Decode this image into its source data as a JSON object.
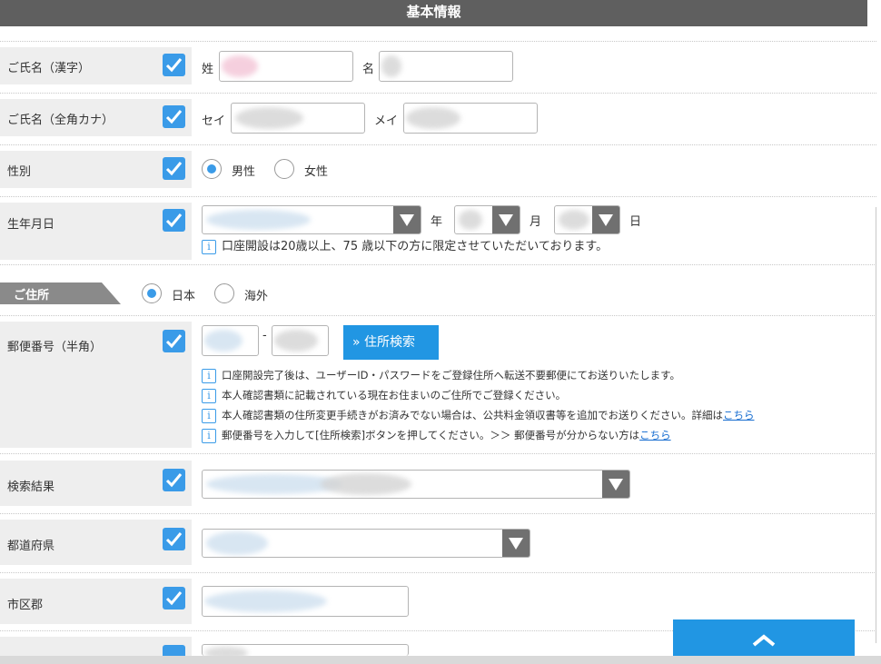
{
  "header": {
    "title": "基本情報"
  },
  "colors": {
    "accent": "#3a9be8",
    "button": "#2196e3",
    "header_bg": "#5f5f5f",
    "label_bg": "#eeeeee"
  },
  "name_kanji": {
    "label": "ご氏名（漢字）",
    "sei_label": "姓",
    "mei_label": "名"
  },
  "name_kana": {
    "label": "ご氏名（全角カナ）",
    "sei_label": "セイ",
    "mei_label": "メイ"
  },
  "gender": {
    "label": "性別",
    "options": [
      "男性",
      "女性"
    ],
    "selected": "男性"
  },
  "birth": {
    "label": "生年月日",
    "year_label": "年",
    "month_label": "月",
    "day_label": "日",
    "note": "口座開設は20歳以上、75 歳以下の方に限定させていただいております。"
  },
  "address": {
    "section_title": "ご住所",
    "options": [
      "日本",
      "海外"
    ],
    "selected": "日本"
  },
  "postal": {
    "label": "郵便番号（半角）",
    "separator": "-",
    "search_button": "» 住所検索",
    "notes": [
      "口座開設完了後は、ユーザーID・パスワードをご登録住所へ転送不要郵便にてお送りいたします。",
      "本人確認書類に記載されている現在お住まいのご住所でご登録ください。",
      "本人確認書類の住所変更手続きがお済みでない場合は、公共料金領収書等を追加でお送りください。詳細は",
      "郵便番号を入力して[住所検索]ボタンを押してください。＞＞ 郵便番号が分からない方は"
    ],
    "link_text": "こちら"
  },
  "search_result": {
    "label": "検索結果"
  },
  "prefecture": {
    "label": "都道府県"
  },
  "city": {
    "label": "市区郡"
  }
}
